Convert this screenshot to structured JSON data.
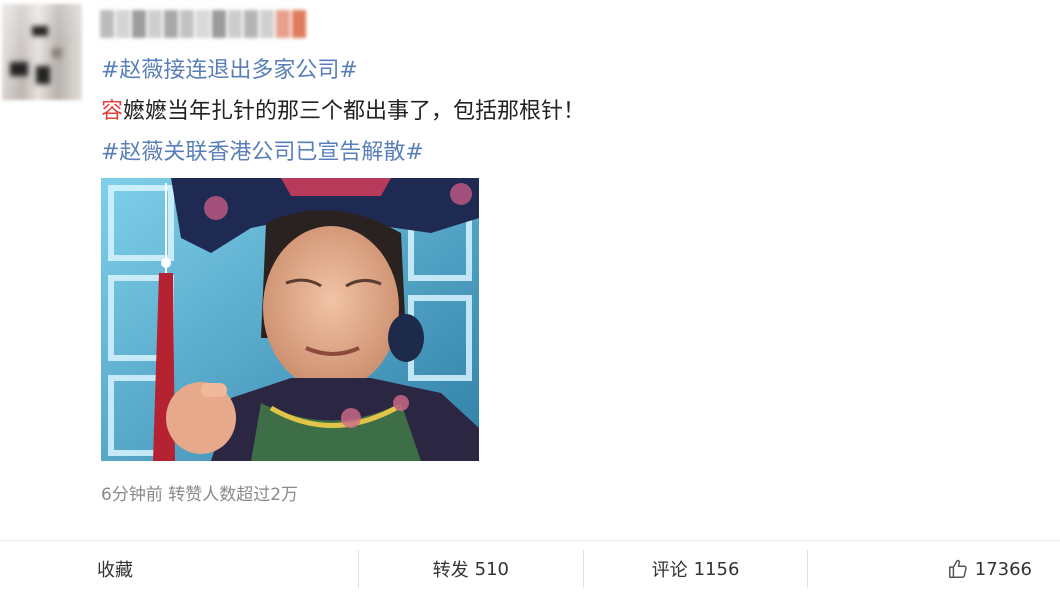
{
  "post": {
    "hashtag_top": "#赵薇接连退出多家公司#",
    "body_highlight": "容",
    "body_text": "嬷嬷当年扎针的那三个都出事了，包括那根针！",
    "hashtag_bottom": "#赵薇关联香港公司已宣告解散#",
    "meta": "6分钟前 转赞人数超过2万"
  },
  "actions": {
    "collect_label": "收藏",
    "repost_label": "转发",
    "repost_count": "510",
    "comment_label": "评论",
    "comment_count": "1156",
    "like_count": "17366",
    "like_icon": "thumbs-up-icon"
  },
  "colors": {
    "hashtag": "#5a7fb8",
    "highlight": "#e0443e",
    "meta": "#8a8a8a"
  }
}
